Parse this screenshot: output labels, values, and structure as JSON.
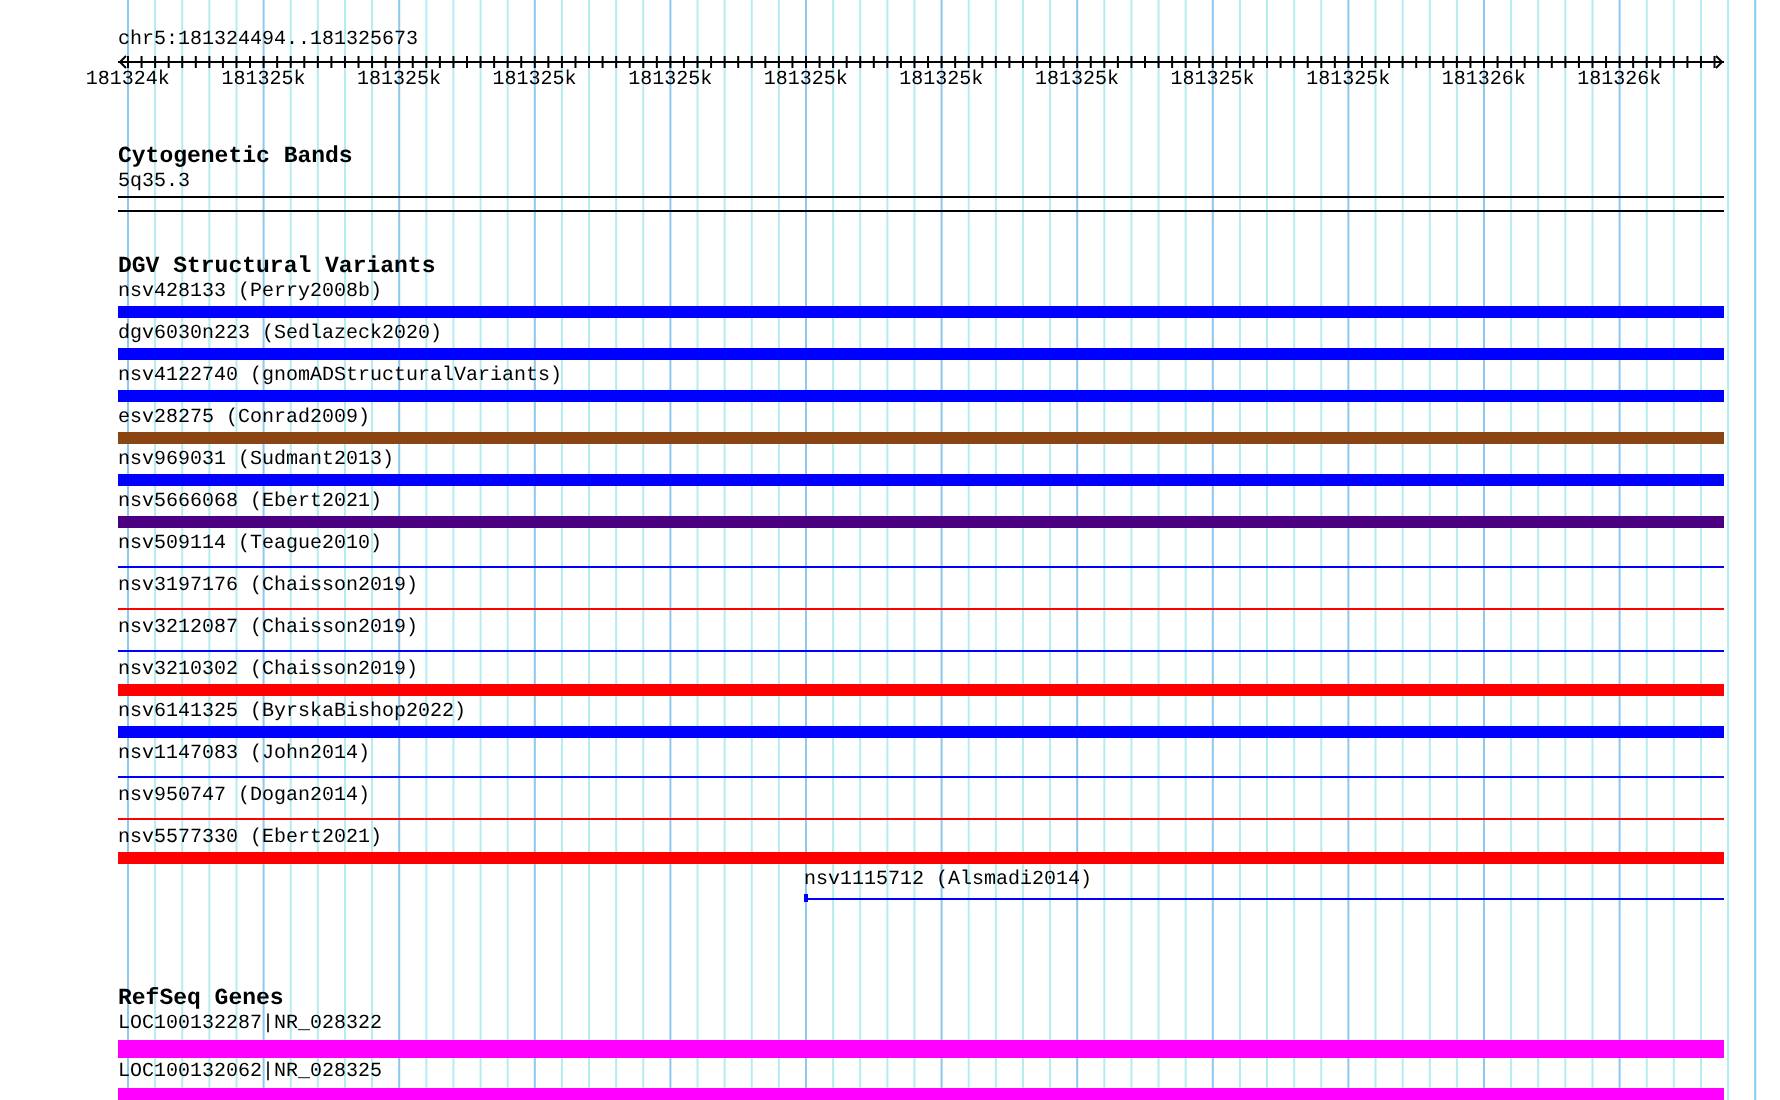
{
  "ruler": {
    "location": "chr5:181324494..181325673",
    "ticks": [
      "181324k",
      "181325k",
      "181325k",
      "181325k",
      "181325k",
      "181325k",
      "181325k",
      "181325k",
      "181325k",
      "181325k",
      "181326k",
      "181326k"
    ]
  },
  "tracks": [
    {
      "title": "Cytogenetic Bands",
      "kind": "bands",
      "features": [
        {
          "label": "5q35.3",
          "kind": "band",
          "color": "#000000"
        }
      ]
    },
    {
      "title": "DGV Structural Variants",
      "kind": "variants",
      "features": [
        {
          "label": "nsv428133 (Perry2008b)",
          "kind": "thick",
          "color": "#0000ff"
        },
        {
          "label": "dgv6030n223 (Sedlazeck2020)",
          "kind": "thick",
          "color": "#0000ff"
        },
        {
          "label": "nsv4122740 (gnomADStructuralVariants)",
          "kind": "thick",
          "color": "#0000ff"
        },
        {
          "label": "esv28275 (Conrad2009)",
          "kind": "thick",
          "color": "#8b4513"
        },
        {
          "label": "nsv969031 (Sudmant2013)",
          "kind": "thick",
          "color": "#0000ff"
        },
        {
          "label": "nsv5666068 (Ebert2021)",
          "kind": "thick",
          "color": "#4b0082"
        },
        {
          "label": "nsv509114 (Teague2010)",
          "kind": "thin",
          "color": "#0000ff"
        },
        {
          "label": "nsv3197176 (Chaisson2019)",
          "kind": "thin",
          "color": "#ff0000"
        },
        {
          "label": "nsv3212087 (Chaisson2019)",
          "kind": "thin",
          "color": "#0000ff"
        },
        {
          "label": "nsv3210302 (Chaisson2019)",
          "kind": "thick",
          "color": "#ff0000"
        },
        {
          "label": "nsv6141325 (ByrskaBishop2022)",
          "kind": "thick",
          "color": "#0000ff"
        },
        {
          "label": "nsv1147083 (John2014)",
          "kind": "thin",
          "color": "#0000ff"
        },
        {
          "label": "nsv950747 (Dogan2014)",
          "kind": "thin",
          "color": "#ff0000"
        },
        {
          "label": "nsv5577330 (Ebert2021)",
          "kind": "thick",
          "color": "#ff0000"
        },
        {
          "label": "nsv1115712 (Alsmadi2014)",
          "kind": "partial",
          "color": "#0000ff"
        }
      ]
    },
    {
      "title": "RefSeq Genes",
      "kind": "genes",
      "features": [
        {
          "label": "LOC100132287|NR_028322",
          "kind": "gene",
          "color": "#ff00ff"
        },
        {
          "label": "LOC100132062|NR_028325",
          "kind": "gene",
          "color": "#ff00ff"
        }
      ]
    }
  ]
}
